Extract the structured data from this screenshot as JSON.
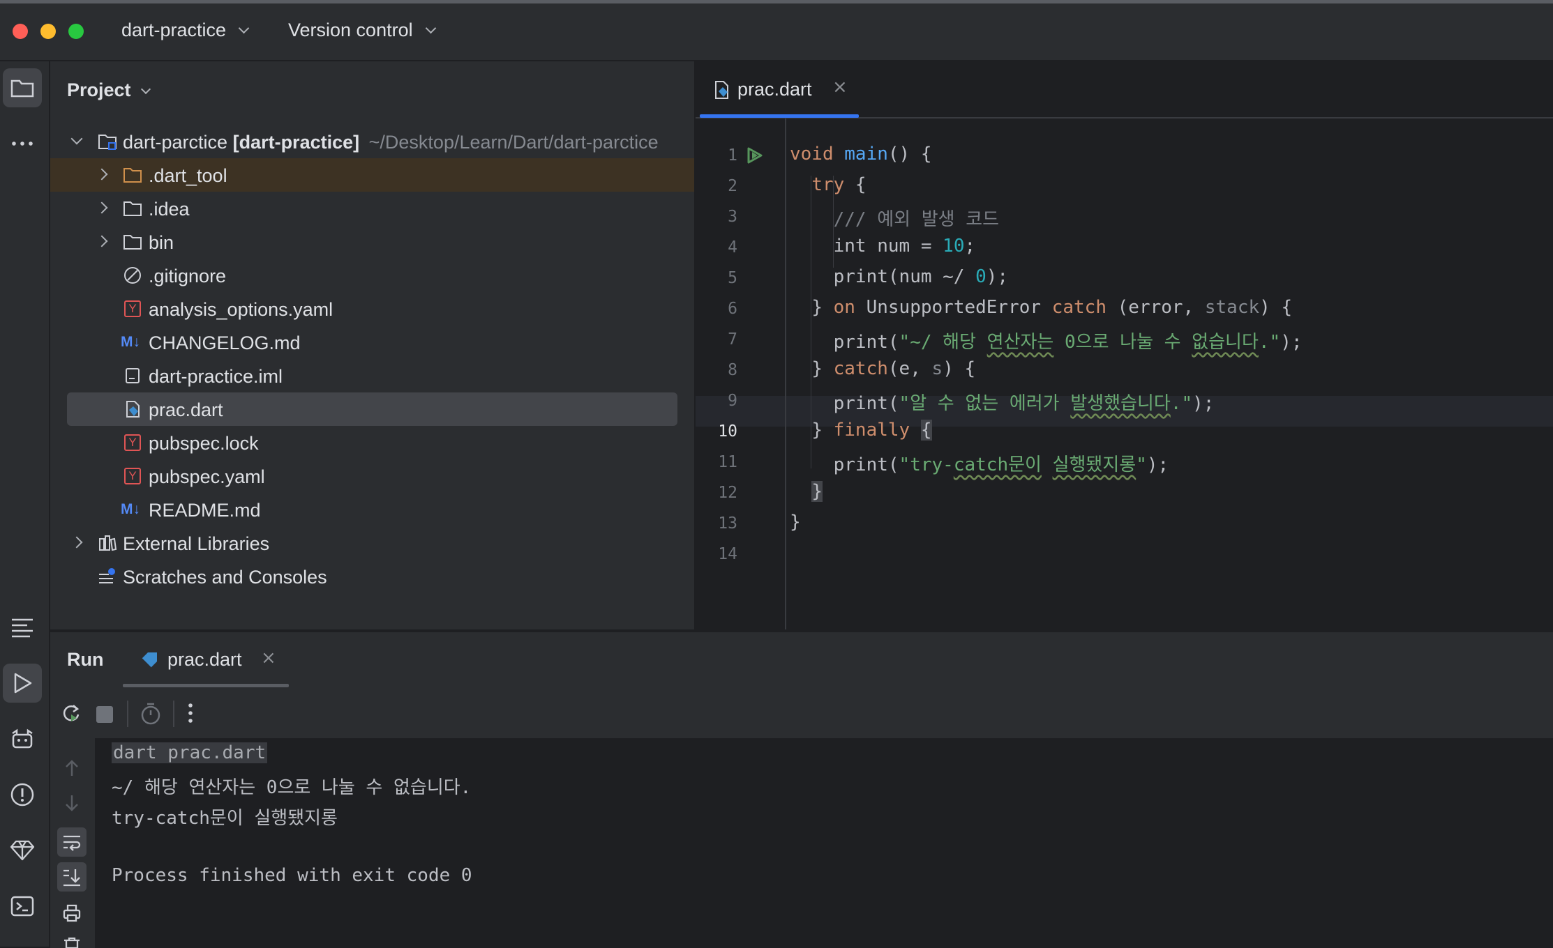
{
  "titlebar": {
    "project_name": "dart-practice",
    "vcs": "Version control"
  },
  "project_panel": {
    "title": "Project",
    "root": {
      "name": "dart-parctice",
      "module": "[dart-practice]",
      "path": "~/Desktop/Learn/Dart/dart-parctice"
    },
    "items": [
      {
        "label": ".dart_tool",
        "icon": "folder-icon"
      },
      {
        "label": ".idea",
        "icon": "folder-icon"
      },
      {
        "label": "bin",
        "icon": "folder-icon"
      },
      {
        "label": ".gitignore",
        "icon": "ignore-file-icon"
      },
      {
        "label": "analysis_options.yaml",
        "icon": "yaml-file-icon"
      },
      {
        "label": "CHANGELOG.md",
        "icon": "markdown-file-icon"
      },
      {
        "label": "dart-practice.iml",
        "icon": "iml-file-icon"
      },
      {
        "label": "prac.dart",
        "icon": "dart-file-icon"
      },
      {
        "label": "pubspec.lock",
        "icon": "yaml-file-icon"
      },
      {
        "label": "pubspec.yaml",
        "icon": "yaml-file-icon"
      },
      {
        "label": "README.md",
        "icon": "markdown-file-icon"
      }
    ],
    "external_libraries": "External Libraries",
    "scratches": "Scratches and Consoles",
    "md_badge": "M↓",
    "yaml_badge": "Y"
  },
  "editor": {
    "tab_label": "prac.dart",
    "current_line": "10",
    "line_numbers": [
      "1",
      "2",
      "3",
      "4",
      "5",
      "6",
      "7",
      "8",
      "9",
      "10",
      "11",
      "12",
      "13",
      "14"
    ],
    "code": {
      "l1_kw": "void",
      "l1_fn": "main",
      "l1_rest": "() {",
      "l2_kw": "try",
      "l2_rest": " {",
      "l3_cmt": "/// 예외 발생 코드",
      "l4_a": "int num = ",
      "l4_num": "10",
      "l4_b": ";",
      "l5_a": "print(num ~/ ",
      "l5_num": "0",
      "l5_b": ");",
      "l6_a": "} ",
      "l6_on": "on",
      "l6_type": " UnsupportedError ",
      "l6_catch": "catch",
      "l6_b": " (error, ",
      "l6_stack": "stack",
      "l6_c": ") {",
      "l7_a": "print(",
      "l7_s1": "\"~/ 해당 ",
      "l7_w1": "연산자는",
      "l7_s2": " 0으로 나눌 수 ",
      "l7_w2": "없습니다",
      "l7_s3": ".\"",
      "l7_b": ");",
      "l8_a": "} ",
      "l8_catch": "catch",
      "l8_b": "(e, ",
      "l8_s": "s",
      "l8_c": ") {",
      "l9_a": "print(",
      "l9_s1": "\"알 수 없는 에러가 ",
      "l9_w1": "발생했습니다",
      "l9_s2": ".\"",
      "l9_b": ");",
      "l10_a": "} ",
      "l10_kw": "finally",
      "l10_sp": " ",
      "l10_brace": "{",
      "l11_a": "print(",
      "l11_s1": "\"try-",
      "l11_w1": "catch문이",
      "l11_sp": " ",
      "l11_w2": "실행됐지롱",
      "l11_s2": "\"",
      "l11_b": ");",
      "l12": "}",
      "l13": "}"
    }
  },
  "run_panel": {
    "title": "Run",
    "tab_label": "prac.dart",
    "console": [
      "dart prac.dart",
      "~/ 해당 연산자는 0으로 나눌 수 없습니다.",
      "try-catch문이 실행됐지롱",
      "",
      "Process finished with exit code 0"
    ]
  },
  "colors": {
    "accent": "#3574f0",
    "run_green": "#57965c",
    "keyword": "#cf8e6d",
    "function": "#56a8f5",
    "string": "#6aab73",
    "number": "#2aacb8"
  }
}
